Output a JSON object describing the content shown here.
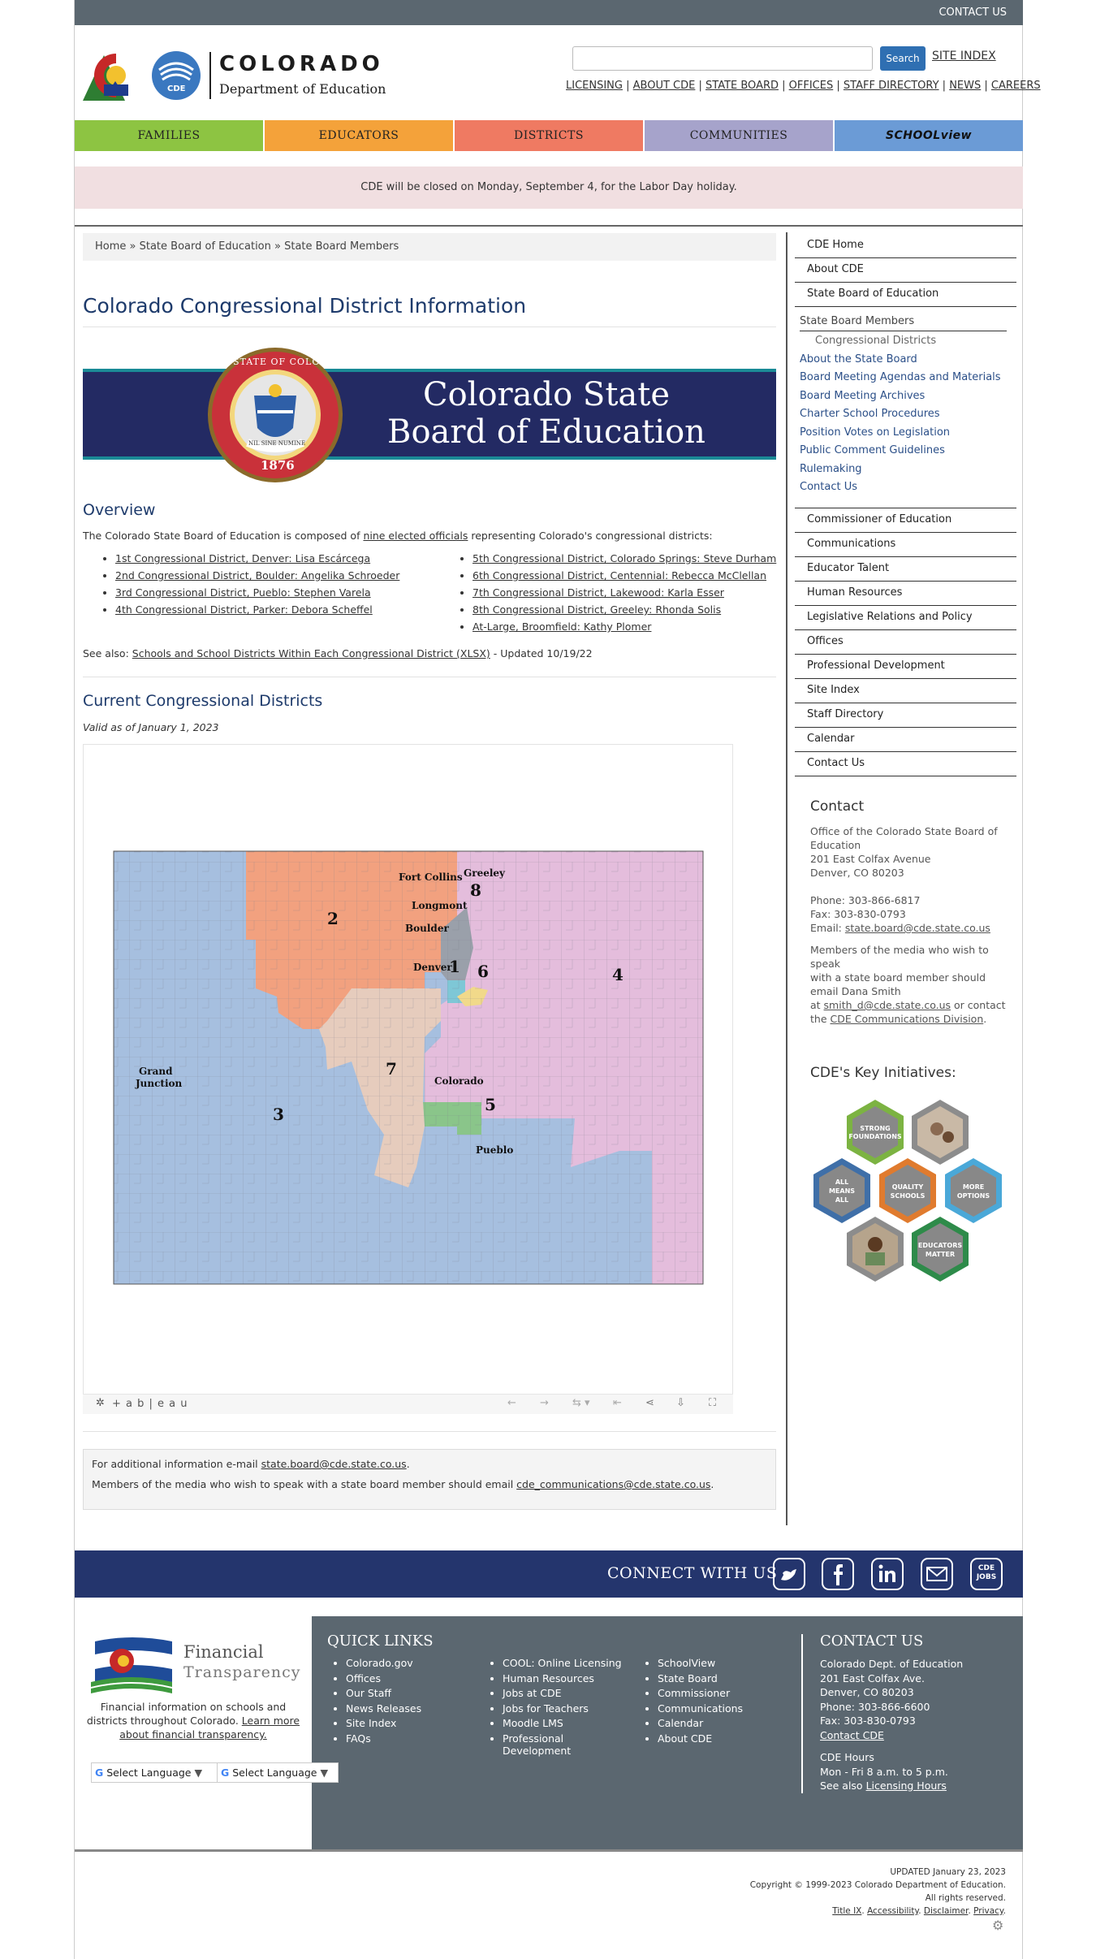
{
  "top_bar": {
    "contact_us": "CONTACT US"
  },
  "header": {
    "logo_title": "COLORADO",
    "logo_subtitle": "Department of Education",
    "logo_badge": "CDE",
    "search_button": "Search",
    "site_index": "SITE INDEX",
    "links": [
      "LICENSING",
      "ABOUT CDE",
      "STATE BOARD",
      "OFFICES",
      "STAFF DIRECTORY",
      "NEWS",
      "CAREERS"
    ]
  },
  "nav": {
    "items": [
      {
        "label": "FAMILIES",
        "color": "#8dc442"
      },
      {
        "label": "EDUCATORS",
        "color": "#f4a23a"
      },
      {
        "label": "DISTRICTS",
        "color": "#ef7a62"
      },
      {
        "label": "COMMUNITIES",
        "color": "#a6a3cb"
      },
      {
        "label": "SCHOOLview",
        "color": "#6b9bd6"
      }
    ]
  },
  "alert": "CDE will be closed on Monday, September 4, for the Labor Day holiday.",
  "breadcrumb": "Home » State Board of Education » State Board Members",
  "main": {
    "page_title": "Colorado Congressional District Information",
    "banner": {
      "line1": "Colorado State",
      "line2": "Board of Education",
      "seal_text": "STATE OF COLORADO",
      "seal_year": "1876",
      "seal_motto": "NIL SINE NUMINE"
    },
    "overview_heading": "Overview",
    "overview_pre": "The Colorado State Board of Education is composed of ",
    "overview_link": "nine elected officials",
    "overview_post": " representing Colorado's congressional districts:",
    "districts_left": [
      "1st Congressional District, Denver: Lisa Escárcega",
      "2nd Congressional District, Boulder: Angelika Schroeder",
      "3rd Congressional District, Pueblo: Stephen Varela",
      "4th Congressional District, Parker: Debora Scheffel"
    ],
    "districts_right": [
      "5th Congressional District, Colorado Springs: Steve Durham",
      "6th Congressional District, Centennial: Rebecca McClellan",
      "7th Congressional District, Lakewood: Karla Esser",
      "8th Congressional District, Greeley: Rhonda Solis",
      "At-Large, Broomfield: Kathy Plomer"
    ],
    "see_also_pre": "See also: ",
    "see_also_link": "Schools and School Districts Within Each Congressional District (XLSX)",
    "see_also_post": " -  Updated 10/19/22",
    "current_heading": "Current Congressional Districts",
    "valid_as_of": "Valid as of January 1, 2023",
    "map_labels": {
      "fort_collins": "Fort Collins",
      "greeley": "Greeley",
      "longmont": "Longmont",
      "boulder": "Boulder",
      "denver": "Denver",
      "grand_junction_1": "Grand",
      "grand_junction_2": "Junction",
      "colorado": "Colorado",
      "pueblo": "Pueblo",
      "d1": "1",
      "d2": "2",
      "d3": "3",
      "d4": "4",
      "d5": "5",
      "d6": "6",
      "d7": "7",
      "d8": "8"
    },
    "tableau": "+ a b | e a u",
    "info_pre": "For additional information e-mail ",
    "info_email": "state.board@cde.state.co.us",
    "info_post": ".",
    "media_pre": "Members of the media who wish to speak with a state board member should email ",
    "media_email": "cde_communications@cde.state.co.us",
    "media_post": "."
  },
  "sidebar": {
    "nav_top": [
      "CDE Home",
      "About CDE",
      "State Board of Education"
    ],
    "sub_title": "State Board Members",
    "sub_active": "Congressional Districts",
    "sub_items": [
      "About the State Board",
      "Board Meeting Agendas and Materials",
      "Board Meeting Archives",
      "Charter School Procedures",
      "Position Votes on Legislation",
      "Public Comment Guidelines",
      "Rulemaking",
      "Contact Us"
    ],
    "nav_bottom": [
      "Commissioner of Education",
      "Communications",
      "Educator Talent",
      "Human Resources",
      "Legislative Relations and Policy",
      "Offices",
      "Professional Development",
      "Site Index",
      "Staff Directory",
      "Calendar",
      "Contact Us"
    ],
    "contact_heading": "Contact",
    "contact_lines": [
      "Office of the Colorado State Board of",
      "Education",
      "201 East Colfax Avenue",
      "Denver, CO 80203"
    ],
    "phone": "Phone: 303-866-6817",
    "fax": "Fax: 303-830-0793",
    "email_label": "Email: ",
    "email": "state.board@cde.state.co.us",
    "media_lines": [
      "Members of the media who wish to speak",
      "with a state board member should",
      "email Dana Smith"
    ],
    "media_at": "at ",
    "media_email": "smith_d@cde.state.co.us",
    "media_or": " or contact",
    "media_the": "the ",
    "media_link": "CDE Communications Division",
    "media_end": ".",
    "key_heading": "CDE's Key Initiatives:",
    "hexes": [
      {
        "l1": "STRONG",
        "l2": "FOUNDATIONS",
        "color": "#7cb342"
      },
      {
        "l1": "",
        "l2": "",
        "color": "#8c8c8c"
      },
      {
        "l1": "ALL",
        "l2": "MEANS",
        "l3": "ALL",
        "color": "#3f6fa8"
      },
      {
        "l1": "QUALITY",
        "l2": "SCHOOLS",
        "color": "#e07b2e"
      },
      {
        "l1": "MORE",
        "l2": "OPTIONS",
        "color": "#4aa8d8"
      },
      {
        "l1": "",
        "l2": "",
        "color": "#8c8c8c"
      },
      {
        "l1": "EDUCATORS",
        "l2": "MATTER",
        "color": "#2e8b4a"
      }
    ]
  },
  "connect": {
    "label": "CONNECT WITH US",
    "jobs_icon": "CDE JOBS"
  },
  "footer": {
    "ft_title1": "Financial",
    "ft_title2": "Transparency",
    "ft_desc1": "Financial information on schools and",
    "ft_desc2_pre": "districts throughout Colorado. ",
    "ft_desc2_link": "Learn more",
    "ft_desc3": "about financial transparency.",
    "select_language": "Select Language",
    "quick_links_heading": "QUICK LINKS",
    "col1": [
      "Colorado.gov",
      "Offices",
      "Our Staff",
      "News Releases",
      "Site Index",
      "FAQs"
    ],
    "col2": [
      "COOL: Online Licensing",
      "Human Resources",
      "Jobs at CDE",
      "Jobs for Teachers",
      "Moodle LMS",
      "Professional Development"
    ],
    "col3": [
      "SchoolView",
      "State Board",
      "Commissioner",
      "Communications",
      "Calendar",
      "About CDE"
    ],
    "contact_heading": "CONTACT US",
    "contact_lines": [
      "Colorado Dept. of Education",
      "201 East Colfax Ave.",
      "Denver, CO 80203",
      "Phone: 303-866-6600",
      "Fax: 303-830-0793"
    ],
    "contact_link": "Contact CDE",
    "hours_heading": "CDE Hours",
    "hours": "Mon - Fri 8 a.m. to 5 p.m.",
    "see_also_pre": "See also ",
    "see_also_link": "Licensing Hours"
  },
  "legal": {
    "updated": "UPDATED January 23, 2023",
    "copyright": "Copyright © 1999-2023 Colorado Department of Education.",
    "rights": "All rights reserved.",
    "links": [
      "Title IX",
      "Accessibility",
      "Disclaimer",
      "Privacy"
    ]
  }
}
